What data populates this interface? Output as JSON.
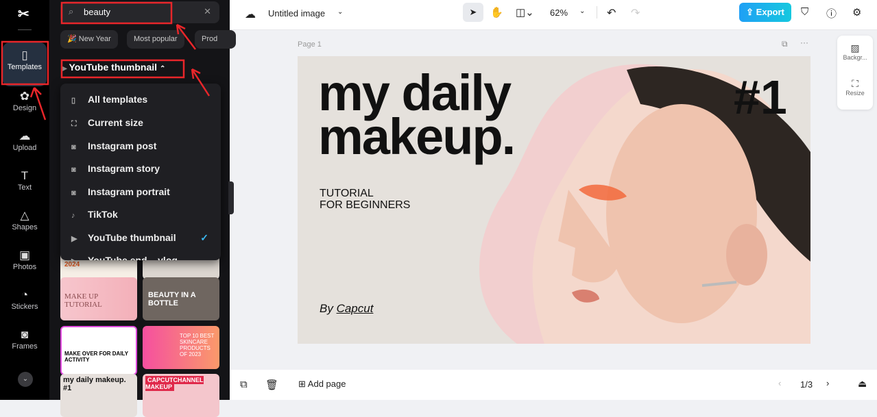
{
  "rail": {
    "items": [
      {
        "label": "Templates",
        "icon": "templates-icon"
      },
      {
        "label": "Design",
        "icon": "design-icon"
      },
      {
        "label": "Upload",
        "icon": "upload-icon"
      },
      {
        "label": "Text",
        "icon": "text-icon"
      },
      {
        "label": "Shapes",
        "icon": "shapes-icon"
      },
      {
        "label": "Photos",
        "icon": "photos-icon"
      },
      {
        "label": "Stickers",
        "icon": "stickers-icon"
      },
      {
        "label": "Frames",
        "icon": "frames-icon"
      }
    ]
  },
  "panel": {
    "search_value": "beauty",
    "chips": [
      "🎉 New Year",
      "Most popular",
      "Prod"
    ],
    "category": "YouTube thumbnail",
    "dropdown": [
      {
        "label": "All templates",
        "icon": "▯"
      },
      {
        "label": "Current size",
        "icon": "⛶"
      },
      {
        "label": "Instagram post",
        "icon": "◙"
      },
      {
        "label": "Instagram story",
        "icon": "◙"
      },
      {
        "label": "Instagram portrait",
        "icon": "◙"
      },
      {
        "label": "TikTok",
        "icon": "♪"
      },
      {
        "label": "YouTube thumbnail",
        "icon": "▶",
        "selected": true
      },
      {
        "label": "YouTube end... vlog",
        "icon": "▶"
      }
    ],
    "thumbnails": [
      {
        "text": "2024"
      },
      {
        "text": ""
      },
      {
        "text": "MAKE UP TUTORIAL"
      },
      {
        "text": "BEAUTY IN A BOTTLE"
      },
      {
        "text": "MAKE OVER FOR DAILY ACTIVITY"
      },
      {
        "text": "TOP 10 BEST SKINCARE PRODUCTS OF 2023"
      },
      {
        "text": "my daily makeup. #1"
      },
      {
        "text": "CAPCUTCHANNEL MAKEUP"
      }
    ]
  },
  "topbar": {
    "title": "Untitled image",
    "zoom": "62%",
    "export": "Export"
  },
  "canvas": {
    "page_label": "Page 1",
    "headline1": "my daily",
    "headline2": "makeup.",
    "number": "#1",
    "sub1": "TUTORIAL",
    "sub2": "FOR BEGINNERS",
    "by": "By ",
    "brand": "Capcut"
  },
  "rpanel": {
    "background": "Backgr...",
    "resize": "Resize"
  },
  "bottom": {
    "add_page": "Add page",
    "page_count": "1/3"
  },
  "colors": {
    "accent": "#1fa0f5",
    "annotation": "#e8262a"
  }
}
